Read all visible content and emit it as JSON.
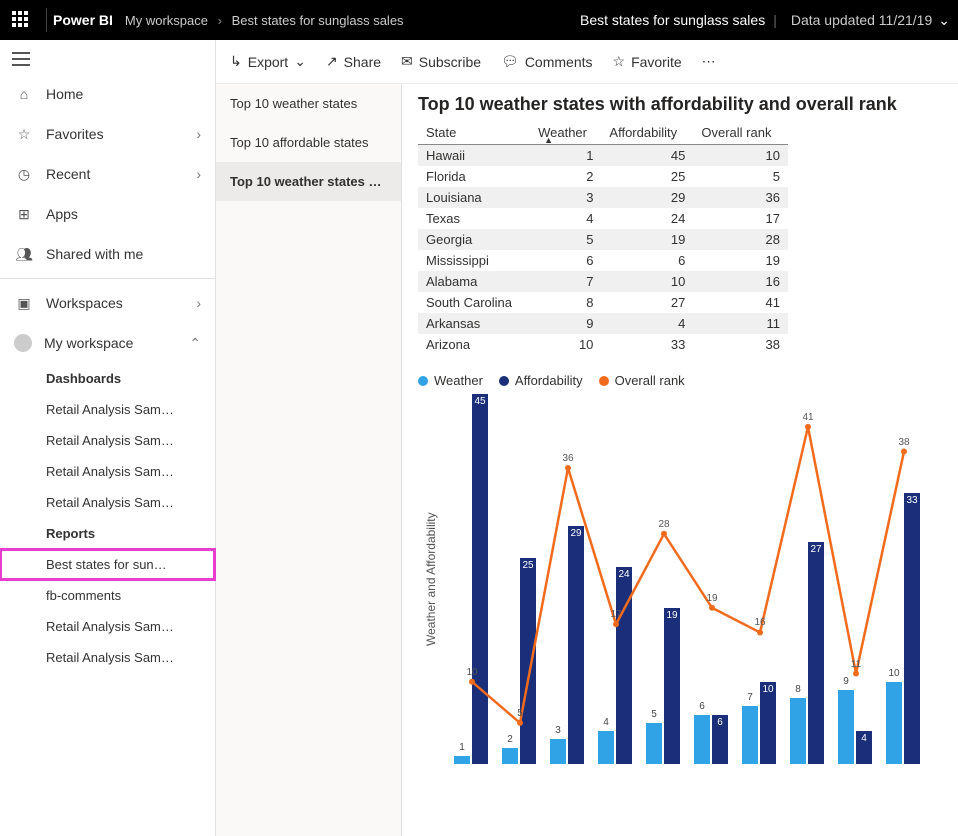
{
  "topbar": {
    "brand": "Power BI",
    "crumb1": "My workspace",
    "crumb2": "Best states for sunglass sales",
    "right_title": "Best states for sunglass sales",
    "updated": "Data updated 11/21/19"
  },
  "nav": {
    "home": "Home",
    "favorites": "Favorites",
    "recent": "Recent",
    "apps": "Apps",
    "shared": "Shared with me",
    "workspaces": "Workspaces",
    "myws": "My workspace",
    "dashboards_hdr": "Dashboards",
    "d1": "Retail Analysis Sam…",
    "d2": "Retail Analysis Sam…",
    "d3": "Retail Analysis Sam…",
    "d4": "Retail Analysis Sam…",
    "reports_hdr": "Reports",
    "r1": "Best states for sun…",
    "r2": "fb-comments",
    "r3": "Retail Analysis Sam…",
    "r4": "Retail Analysis Sam…"
  },
  "toolbar": {
    "export": "Export",
    "share": "Share",
    "subscribe": "Subscribe",
    "comments": "Comments",
    "favorite": "Favorite"
  },
  "pages": {
    "p1": "Top 10 weather states",
    "p2": "Top 10 affordable states",
    "p3": "Top 10 weather states w…"
  },
  "report": {
    "title": "Top 10 weather states with affordability and overall rank",
    "headers": {
      "state": "State",
      "weather": "Weather",
      "afford": "Affordability",
      "rank": "Overall rank"
    },
    "legend": {
      "weather": "Weather",
      "afford": "Affordability",
      "rank": "Overall rank"
    },
    "ylabel": "Weather and Affordability"
  },
  "chart_data": {
    "type": "bar+line",
    "categories": [
      "Hawaii",
      "Florida",
      "Louisiana",
      "Texas",
      "Georgia",
      "Mississippi",
      "Alabama",
      "South Carolina",
      "Arkansas",
      "Arizona"
    ],
    "series": [
      {
        "name": "Weather",
        "values": [
          1,
          2,
          3,
          4,
          5,
          6,
          7,
          8,
          9,
          10
        ]
      },
      {
        "name": "Affordability",
        "values": [
          45,
          25,
          29,
          24,
          19,
          6,
          10,
          27,
          4,
          33
        ]
      },
      {
        "name": "Overall rank",
        "values": [
          10,
          5,
          36,
          17,
          28,
          19,
          16,
          41,
          11,
          38
        ]
      }
    ],
    "ylim": [
      0,
      45
    ],
    "legend_position": "top"
  }
}
